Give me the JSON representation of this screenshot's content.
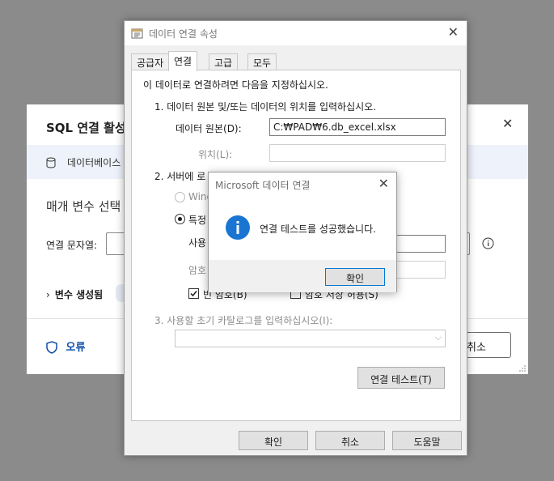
{
  "background_dialog": {
    "title": "SQL 연결 활성",
    "info_text": "데이터베이스",
    "section_title": "매개 변수 선택",
    "connection_label": "연결 문자열:",
    "variables_label": "변수 생성됨",
    "error_label": "오류",
    "cancel_label": "취소"
  },
  "window": {
    "title": "데이터 연결 속성",
    "tabs": [
      "공급자",
      "연결",
      "고급",
      "모두"
    ],
    "active_tab": "연결",
    "intro": "이 데이터로 연결하려면 다음을 지정하십시오.",
    "step1": "1. 데이터 원본 및/또는 데이터의 위치를 입력하십시오.",
    "datasource_label": "데이터 원본(D):",
    "datasource_value": "C:₩PAD₩6.db_excel.xlsx",
    "location_label": "위치(L):",
    "location_value": "",
    "step2": "2. 서버에 로",
    "radio_windows": "Wind",
    "radio_specific": "특정",
    "user_label": "사용",
    "password_label": "암호",
    "blank_password_label": "빈 암호(B)",
    "allow_save_password_label": "암호 저장 허용(S)",
    "step3": "3. 사용할 초기 카탈로그를 입력하십시오(I):",
    "test_connection_button": "연결 테스트(T)",
    "ok_button": "확인",
    "cancel_button": "취소",
    "help_button": "도움말"
  },
  "message_box": {
    "title": "Microsoft 데이터 연결",
    "message": "연결 테스트를 성공했습니다.",
    "ok_button": "확인"
  },
  "colors": {
    "info_blue": "#1a75d2",
    "link_blue": "#0f4ea8",
    "overlay_gray": "#8b8b8b"
  }
}
